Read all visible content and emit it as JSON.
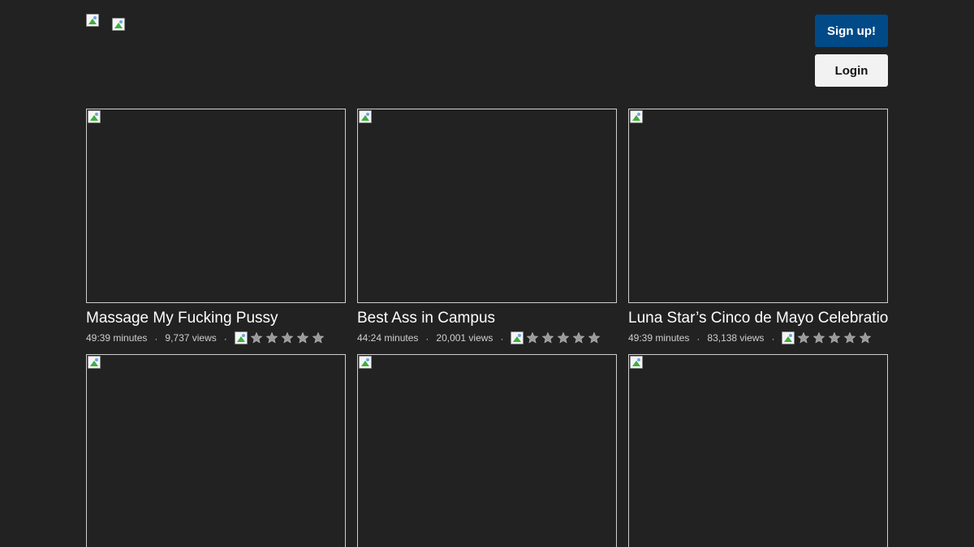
{
  "header": {
    "signup_label": "Sign up!",
    "login_label": "Login"
  },
  "videos": [
    {
      "title": "Massage My Fucking Pussy",
      "duration": "49:39 minutes",
      "views": "9,737 views",
      "rating_stars": 5
    },
    {
      "title": "Best Ass in Campus",
      "duration": "44:24 minutes",
      "views": "20,001 views",
      "rating_stars": 5
    },
    {
      "title": "Luna Star’s Cinco de Mayo Celebration",
      "duration": "49:39 minutes",
      "views": "83,138 views",
      "rating_stars": 5
    },
    {
      "title": "",
      "duration": "",
      "views": ""
    },
    {
      "title": "",
      "duration": "",
      "views": ""
    },
    {
      "title": "",
      "duration": "",
      "views": ""
    }
  ],
  "separator": "·",
  "colors": {
    "background": "#222222",
    "signup_button": "#004a87",
    "login_button": "#f2f2f2",
    "star": "#9a9a9a"
  },
  "icons": {
    "broken_image": "broken-image-icon",
    "star": "star-icon"
  }
}
